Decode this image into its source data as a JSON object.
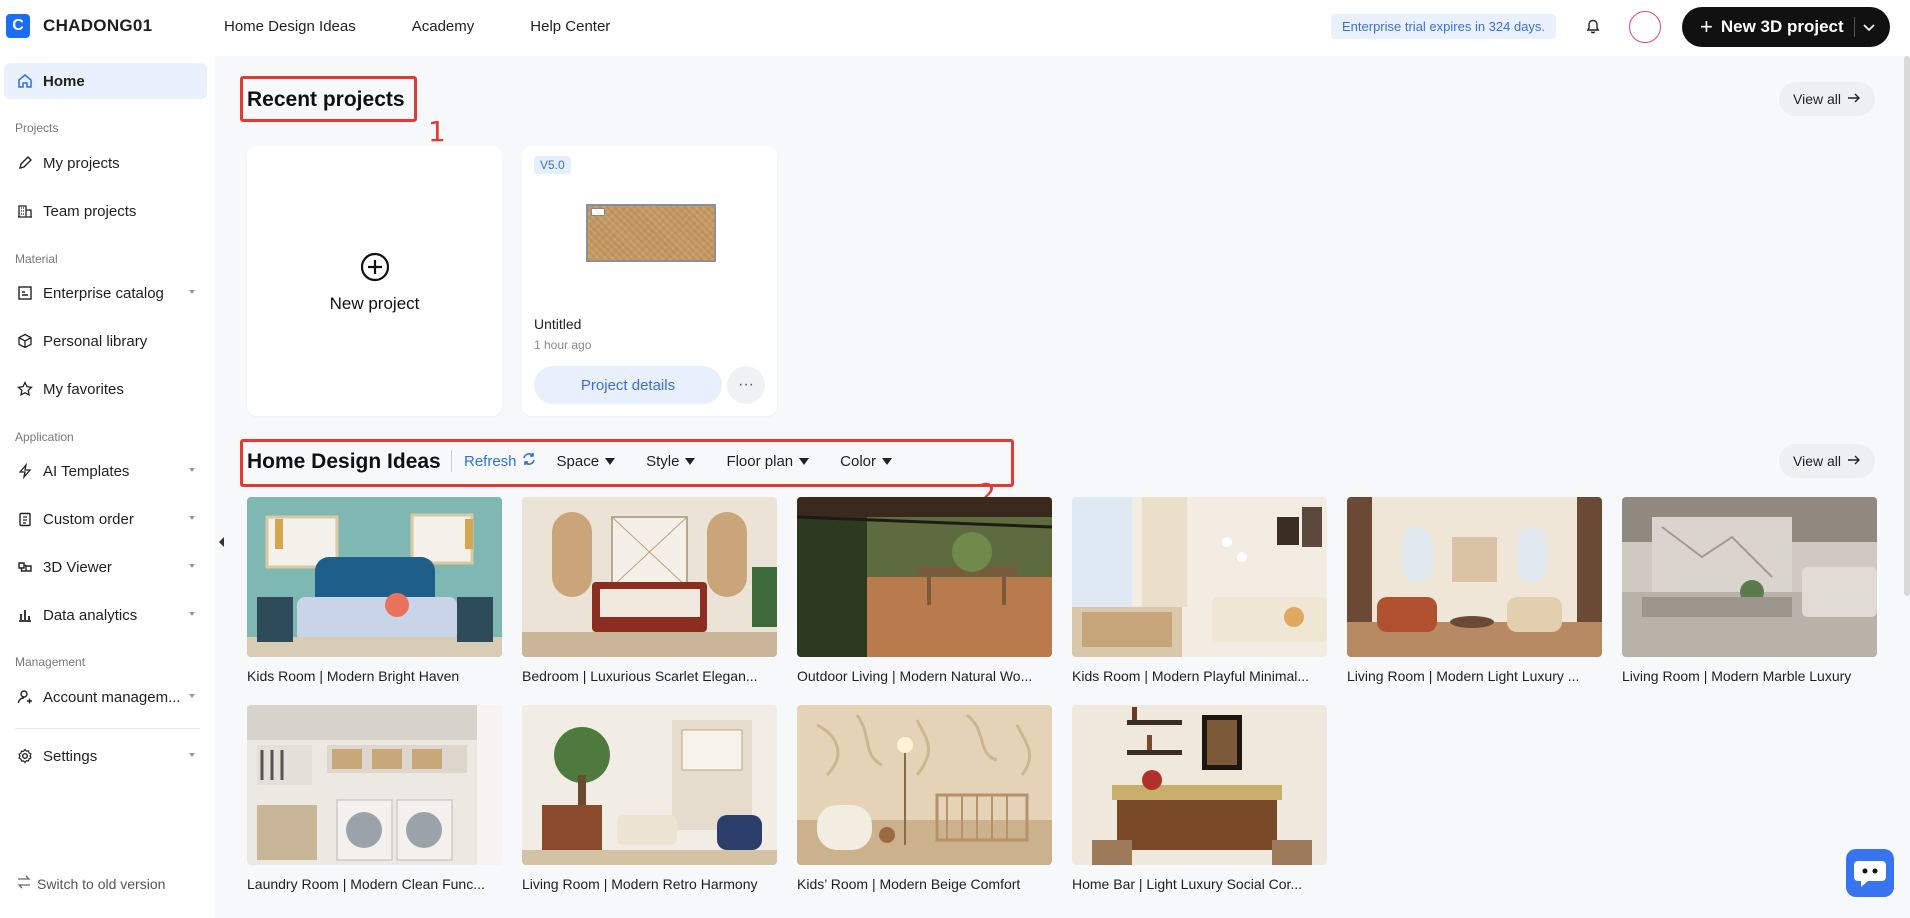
{
  "brand": {
    "logo_letter": "C",
    "name": "CHADONG01"
  },
  "topnav": {
    "items": [
      "Home Design Ideas",
      "Academy",
      "Help Center"
    ]
  },
  "trial_notice": "Enterprise trial expires in 324 days.",
  "new_project_button": "New 3D project",
  "sidebar": {
    "home": "Home",
    "groups": {
      "projects": "Projects",
      "material": "Material",
      "application": "Application",
      "management": "Management"
    },
    "items": {
      "my_projects": "My projects",
      "team_projects": "Team projects",
      "enterprise_catalog": "Enterprise catalog",
      "personal_library": "Personal library",
      "my_favorites": "My favorites",
      "ai_templates": "AI Templates",
      "custom_order": "Custom order",
      "viewer_3d": "3D Viewer",
      "data_analytics": "Data analytics",
      "account_management": "Account managem...",
      "settings": "Settings"
    },
    "switch_old": "Switch to old version"
  },
  "recent": {
    "title": "Recent projects",
    "view_all": "View all",
    "annotation": "1",
    "new_project": "New project",
    "project": {
      "version": "V5.0",
      "name": "Untitled",
      "time": "1 hour ago",
      "details_button": "Project details",
      "more": "···"
    }
  },
  "ideas": {
    "title": "Home Design Ideas",
    "view_all": "View all",
    "annotation": "2",
    "refresh": "Refresh",
    "filters": [
      "Space",
      "Style",
      "Floor plan",
      "Color"
    ],
    "items": [
      {
        "caption": "Kids Room | Modern Bright Haven"
      },
      {
        "caption": "Bedroom | Luxurious Scarlet Elegan..."
      },
      {
        "caption": "Outdoor Living | Modern Natural Wo..."
      },
      {
        "caption": "Kids Room | Modern Playful Minimal..."
      },
      {
        "caption": "Living Room | Modern Light Luxury ..."
      },
      {
        "caption": "Living Room | Modern Marble Luxury"
      },
      {
        "caption": "Laundry Room | Modern Clean Func..."
      },
      {
        "caption": "Living Room | Modern Retro Harmony"
      },
      {
        "caption": "Kids’ Room | Modern Beige Comfort"
      },
      {
        "caption": "Home Bar | Light Luxury Social Cor..."
      }
    ]
  },
  "colors": {
    "accent": "#1b6ef3",
    "annotation_red": "#e53935",
    "active_bg": "#e9f1fd"
  }
}
